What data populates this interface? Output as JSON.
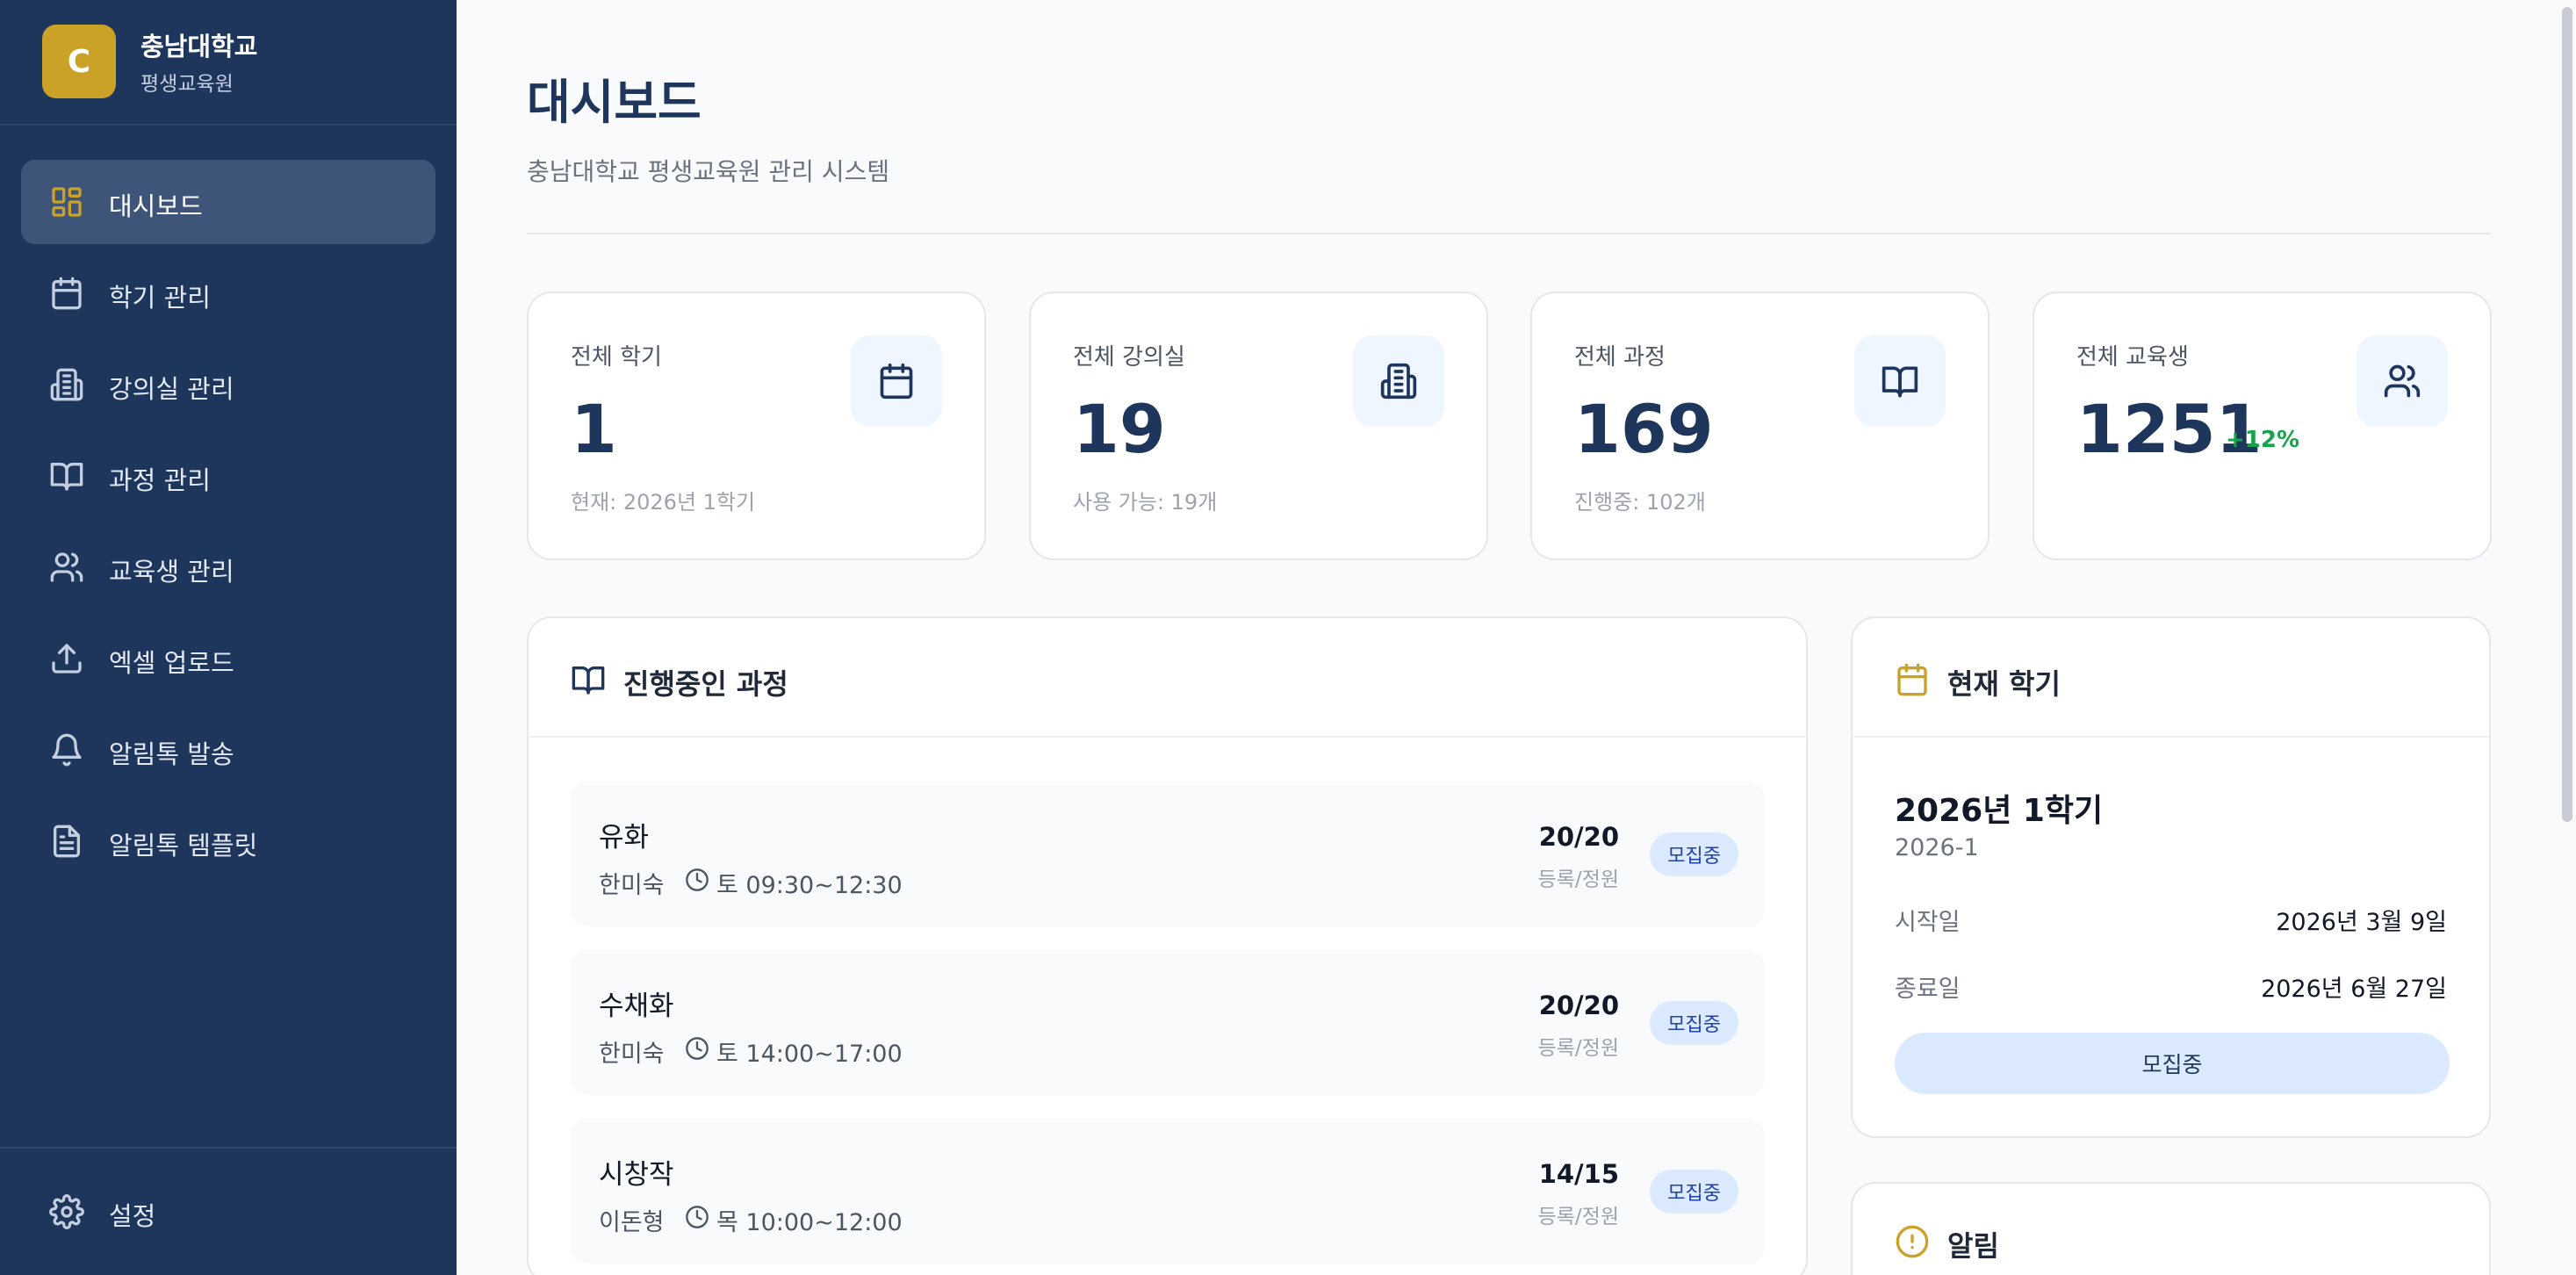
{
  "brand": {
    "logo_letter": "C",
    "name": "충남대학교",
    "subtitle": "평생교육원"
  },
  "sidebar": {
    "items": [
      {
        "label": "대시보드",
        "icon": "dashboard-icon",
        "active": true
      },
      {
        "label": "학기 관리",
        "icon": "calendar-icon"
      },
      {
        "label": "강의실 관리",
        "icon": "building-icon"
      },
      {
        "label": "과정 관리",
        "icon": "book-icon"
      },
      {
        "label": "교육생 관리",
        "icon": "users-icon"
      },
      {
        "label": "엑셀 업로드",
        "icon": "upload-icon"
      },
      {
        "label": "알림톡 발송",
        "icon": "bell-icon"
      },
      {
        "label": "알림톡 템플릿",
        "icon": "document-icon"
      }
    ],
    "settings_label": "설정"
  },
  "header": {
    "title": "대시보드",
    "subtitle": "충남대학교 평생교육원 관리 시스템"
  },
  "stats": [
    {
      "label": "전체 학기",
      "value": "1",
      "note": "현재: 2026년 1학기",
      "icon": "calendar-icon"
    },
    {
      "label": "전체 강의실",
      "value": "19",
      "note": "사용 가능: 19개",
      "icon": "building-icon"
    },
    {
      "label": "전체 과정",
      "value": "169",
      "note": "진행중: 102개",
      "icon": "book-icon"
    },
    {
      "label": "전체 교육생",
      "value": "1251",
      "trend": "+12%",
      "icon": "users-icon"
    }
  ],
  "courses_panel": {
    "title": "진행중인 과정",
    "items": [
      {
        "name": "유화",
        "teacher": "한미숙",
        "time": "토 09:30~12:30",
        "count": "20/20",
        "count_label": "등록/정원",
        "status": "모집중"
      },
      {
        "name": "수채화",
        "teacher": "한미숙",
        "time": "토 14:00~17:00",
        "count": "20/20",
        "count_label": "등록/정원",
        "status": "모집중"
      },
      {
        "name": "시창작",
        "teacher": "이돈형",
        "time": "목 10:00~12:00",
        "count": "14/15",
        "count_label": "등록/정원",
        "status": "모집중"
      }
    ]
  },
  "semester_panel": {
    "title": "현재 학기",
    "name": "2026년 1학기",
    "code": "2026-1",
    "start_label": "시작일",
    "start_value": "2026년 3월 9일",
    "end_label": "종료일",
    "end_value": "2026년 6월 27일",
    "status": "모집중"
  },
  "alerts_panel": {
    "title": "알림"
  },
  "colors": {
    "sidebar": "#1e355c",
    "accent_gold": "#c9a227",
    "badge_bg": "#dbeafe",
    "trend_green": "#16a34a"
  }
}
